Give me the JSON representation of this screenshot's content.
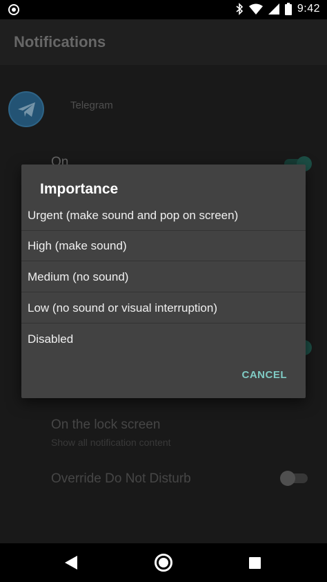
{
  "status_bar": {
    "time": "9:42",
    "icons": [
      "record-icon",
      "bluetooth-icon",
      "wifi-icon",
      "signal-icon",
      "battery-icon"
    ]
  },
  "app_bar": {
    "title": "Notifications"
  },
  "background": {
    "app_name": "Telegram",
    "on_label": "On",
    "lock_screen_title": "On the lock screen",
    "lock_screen_subtitle": "Show all notification content",
    "dnd_label": "Override Do Not Disturb"
  },
  "dialog": {
    "title": "Importance",
    "options": [
      {
        "label": "Urgent (make sound and pop on screen)"
      },
      {
        "label": "High (make sound)"
      },
      {
        "label": "Medium (no sound)"
      },
      {
        "label": "Low (no sound or visual interruption)"
      },
      {
        "label": "Disabled"
      }
    ],
    "cancel_label": "CANCEL"
  },
  "nav_bar": {
    "icons": [
      "back-icon",
      "home-icon",
      "recents-icon"
    ]
  },
  "colors": {
    "accent": "#7fcbc4",
    "dialog_bg": "#424242",
    "toggle_on": "#26685c",
    "telegram_blue": "#2f6f9b"
  }
}
